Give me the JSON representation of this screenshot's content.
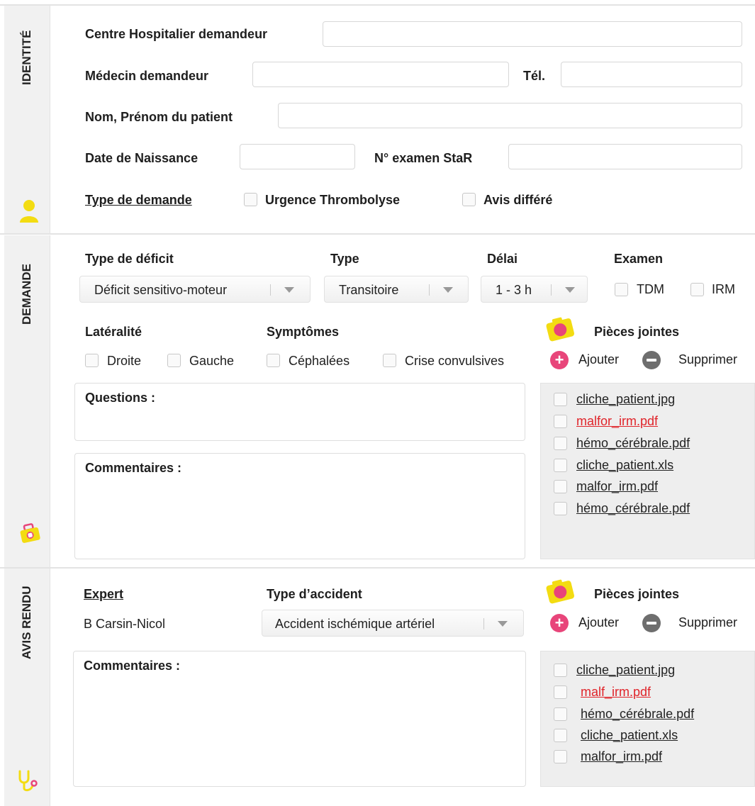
{
  "colors": {
    "accent_yellow": "#f3dc12",
    "accent_pink": "#e8457a",
    "error_red": "#e0242a"
  },
  "identite": {
    "tab_label": "IDENTITÉ",
    "tab_icon": "user-icon",
    "centre_label": "Centre Hospitalier demandeur",
    "medecin_label": "Médecin demandeur",
    "tel_label": "Tél.",
    "patient_label": "Nom, Prénom du patient",
    "naissance_label": "Date de Naissance",
    "examen_star_label": "N° examen StaR",
    "type_demande_label": "Type de demande",
    "urgence_label": "Urgence Thrombolyse",
    "avis_differe_label": "Avis différé"
  },
  "demande": {
    "tab_label": "DEMANDE",
    "tab_icon": "medkit-icon",
    "deficit_label": "Type de déficit",
    "deficit_value": "Déficit sensitivo-moteur",
    "type_label": "Type",
    "type_value": "Transitoire",
    "delai_label": "Délai",
    "delai_value": "1 - 3 h",
    "examen_label": "Examen",
    "tdm_label": "TDM",
    "irm_label": "IRM",
    "lateralite_label": "Latéralité",
    "droite_label": "Droite",
    "gauche_label": "Gauche",
    "symptomes_label": "Symptômes",
    "cephalees_label": "Céphalées",
    "crise_label": "Crise convulsives",
    "pieces_label": "Pièces jointes",
    "ajouter_label": "Ajouter",
    "supprimer_label": "Supprimer",
    "questions_label": "Questions :",
    "commentaires_label": "Commentaires :",
    "files": [
      {
        "name": "cliche_patient.jpg",
        "status": "normal"
      },
      {
        "name": "malfor_irm.pdf",
        "status": "error"
      },
      {
        "name": "hémo_cérébrale.pdf",
        "status": "normal"
      },
      {
        "name": "cliche_patient.xls",
        "status": "normal"
      },
      {
        "name": "malfor_irm.pdf",
        "status": "normal"
      },
      {
        "name": "hémo_cérébrale.pdf",
        "status": "normal"
      }
    ]
  },
  "avis": {
    "tab_label": "AVIS RENDU",
    "tab_icon": "stethoscope-icon",
    "expert_label": "Expert",
    "expert_value": "B Carsin-Nicol",
    "accident_label": "Type d’accident",
    "accident_value": "Accident ischémique artériel",
    "pieces_label": "Pièces jointes",
    "ajouter_label": "Ajouter",
    "supprimer_label": "Supprimer",
    "commentaires_label": "Commentaires :",
    "files": [
      {
        "name": "cliche_patient.jpg",
        "status": "normal"
      },
      {
        "name": "malf_irm.pdf",
        "status": "error"
      },
      {
        "name": "hémo_cérébrale.pdf",
        "status": "normal"
      },
      {
        "name": "cliche_patient.xls",
        "status": "normal"
      },
      {
        "name": "malfor_irm.pdf",
        "status": "normal"
      }
    ]
  }
}
